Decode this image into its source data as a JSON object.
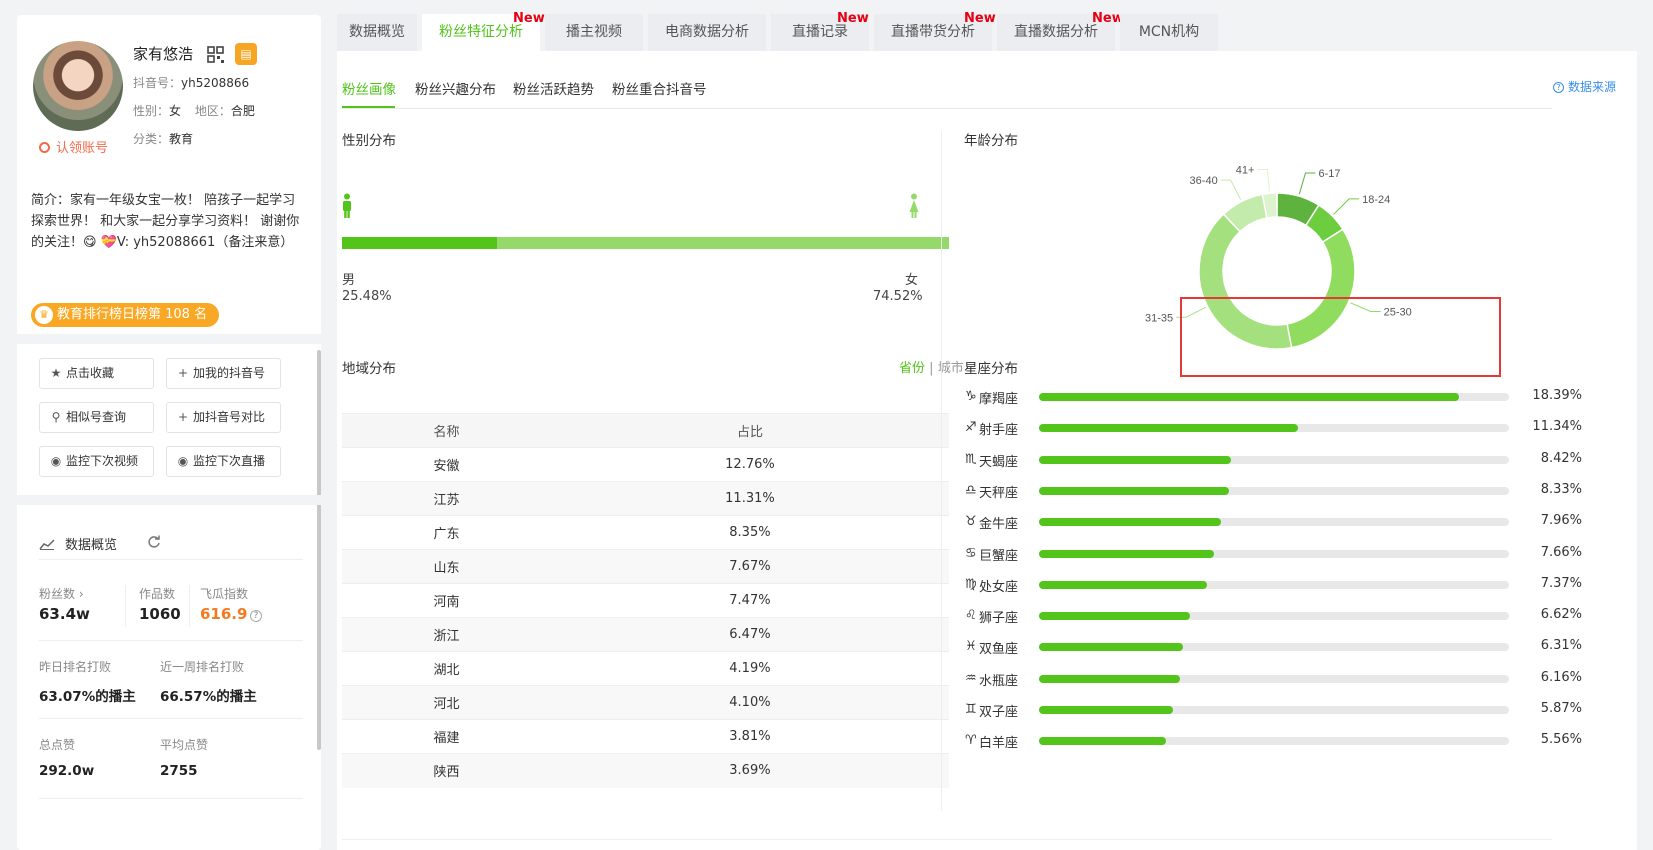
{
  "profile": {
    "name": "家有悠浩",
    "douyin_id_label": "抖音号：",
    "douyin_id": "yh5208866",
    "gender_label": "性别：",
    "gender": "女",
    "region_label": "地区：",
    "region": "合肥",
    "category_label": "分类：",
    "category": "教育",
    "claim_label": "认领账号",
    "bio": "简介：家有一年级女宝一枚！ 陪孩子一起学习探索世界！ 和大家一起分享学习资料！ 谢谢你的关注！😋 💝V: yh52088661（备注来意）",
    "rank_badge": "教育排行榜日榜第 108 名"
  },
  "actions": {
    "favorite": "点击收藏",
    "add_mine": "加我的抖音号",
    "similar": "相似号查询",
    "add_compare": "加抖音号对比",
    "monitor_video": "监控下次视频",
    "monitor_live": "监控下次直播"
  },
  "overview": {
    "title": "数据概览",
    "fans_label": "粉丝数",
    "fans_value": "63.4w",
    "works_label": "作品数",
    "works_value": "1060",
    "index_label": "飞瓜指数",
    "index_value": "616.9",
    "yesterday_label": "昨日排名打败",
    "yesterday_value": "63.07%的播主",
    "week_label": "近一周排名打败",
    "week_value": "66.57%的播主",
    "total_likes_label": "总点赞",
    "total_likes_value": "292.0w",
    "avg_likes_label": "平均点赞",
    "avg_likes_value": "2755"
  },
  "tabs": [
    {
      "label": "数据概览",
      "new": ""
    },
    {
      "label": "粉丝特征分析",
      "new": "New"
    },
    {
      "label": "播主视频",
      "new": ""
    },
    {
      "label": "电商数据分析",
      "new": ""
    },
    {
      "label": "直播记录",
      "new": "New"
    },
    {
      "label": "直播带货分析",
      "new": "New"
    },
    {
      "label": "直播数据分析",
      "new": "New"
    },
    {
      "label": "MCN机构",
      "new": ""
    }
  ],
  "subtabs": [
    "粉丝画像",
    "粉丝兴趣分布",
    "粉丝活跃趋势",
    "粉丝重合抖音号"
  ],
  "data_source": "数据来源",
  "gender_section": {
    "title": "性别分布",
    "male_label": "男",
    "male_value": "25.48%",
    "female_label": "女",
    "female_value": "74.52%",
    "male_share": 0.2548,
    "male_color": "#52c41a",
    "female_color": "#95d96a"
  },
  "region_section": {
    "title": "地域分布",
    "toggle_province": "省份",
    "toggle_sep": "|",
    "toggle_city": "城市",
    "col_name": "名称",
    "col_share": "占比",
    "rows": [
      [
        "安徽",
        "12.76%"
      ],
      [
        "江苏",
        "11.31%"
      ],
      [
        "广东",
        "8.35%"
      ],
      [
        "山东",
        "7.67%"
      ],
      [
        "河南",
        "7.47%"
      ],
      [
        "浙江",
        "6.47%"
      ],
      [
        "湖北",
        "4.19%"
      ],
      [
        "河北",
        "4.10%"
      ],
      [
        "福建",
        "3.81%"
      ],
      [
        "陕西",
        "3.69%"
      ]
    ]
  },
  "age_section": {
    "title": "年龄分布"
  },
  "chart_data": {
    "type": "pie",
    "categories": [
      "6-17",
      "18-24",
      "25-30",
      "31-35",
      "36-40",
      "41+"
    ],
    "values": [
      9,
      7,
      31,
      41,
      9,
      3
    ],
    "colors": [
      "#5db33d",
      "#6ccd3e",
      "#8fdc5e",
      "#a4e07e",
      "#c3ebac",
      "#dcf3cd"
    ]
  },
  "zodiac_section": {
    "title": "星座分布",
    "items": [
      {
        "icon": "♑",
        "name": "摩羯座",
        "value": "18.39%",
        "pct": 18.39
      },
      {
        "icon": "♐",
        "name": "射手座",
        "value": "11.34%",
        "pct": 11.34
      },
      {
        "icon": "♏",
        "name": "天蝎座",
        "value": "8.42%",
        "pct": 8.42
      },
      {
        "icon": "♎",
        "name": "天秤座",
        "value": "8.33%",
        "pct": 8.33
      },
      {
        "icon": "♉",
        "name": "金牛座",
        "value": "7.96%",
        "pct": 7.96
      },
      {
        "icon": "♋",
        "name": "巨蟹座",
        "value": "7.66%",
        "pct": 7.66
      },
      {
        "icon": "♍",
        "name": "处女座",
        "value": "7.37%",
        "pct": 7.37
      },
      {
        "icon": "♌",
        "name": "狮子座",
        "value": "6.62%",
        "pct": 6.62
      },
      {
        "icon": "♓",
        "name": "双鱼座",
        "value": "6.31%",
        "pct": 6.31
      },
      {
        "icon": "♒",
        "name": "水瓶座",
        "value": "6.16%",
        "pct": 6.16
      },
      {
        "icon": "♊",
        "name": "双子座",
        "value": "5.87%",
        "pct": 5.87
      },
      {
        "icon": "♈",
        "name": "白羊座",
        "value": "5.56%",
        "pct": 5.56
      }
    ]
  }
}
